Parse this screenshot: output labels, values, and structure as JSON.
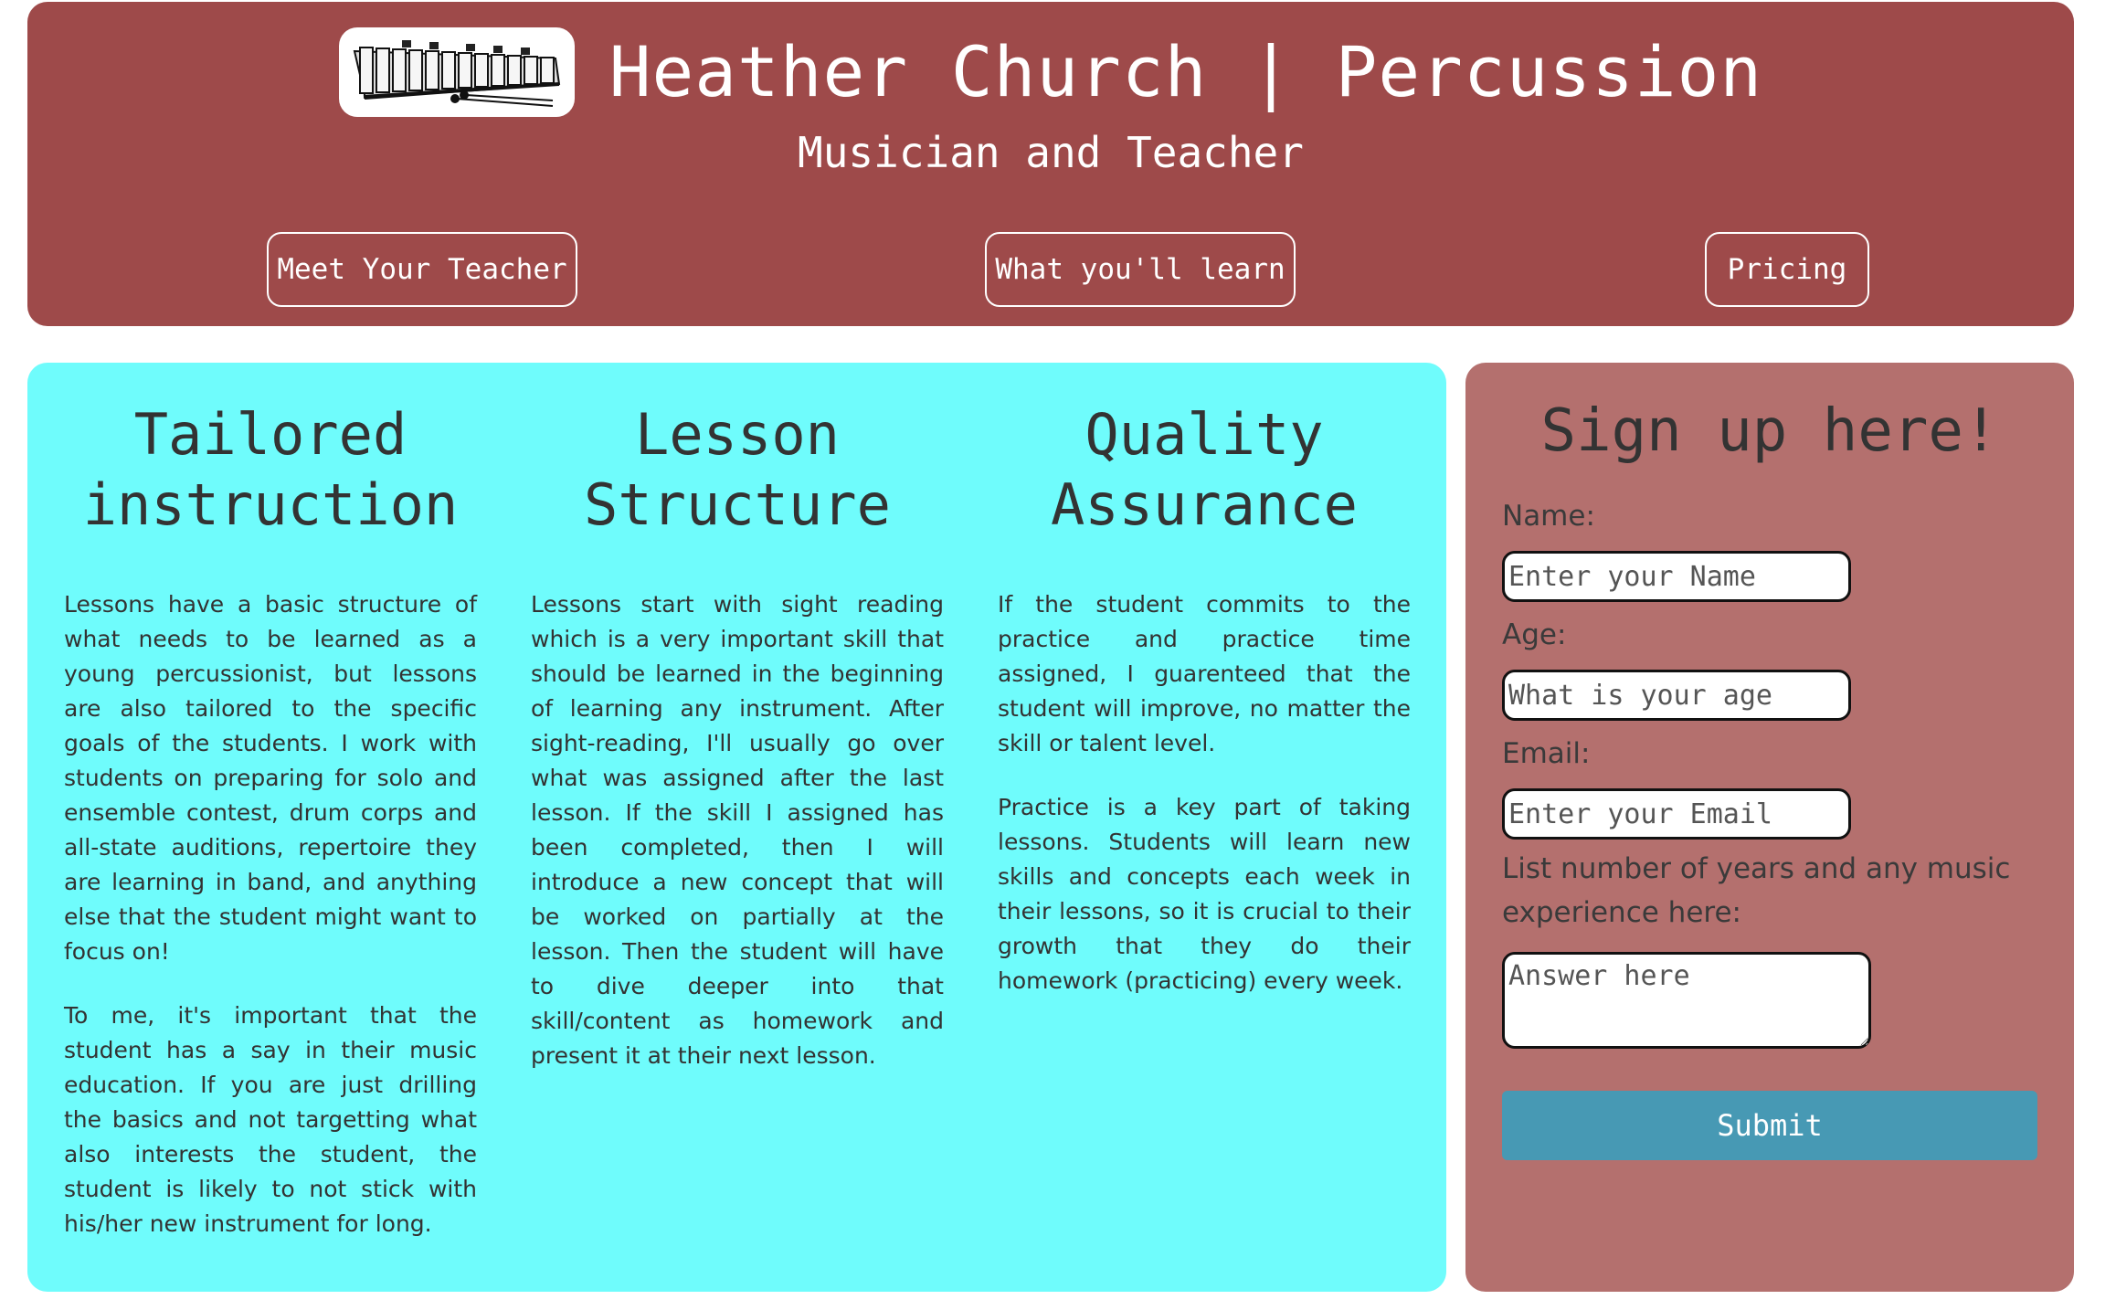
{
  "header": {
    "title": "Heather Church | Percussion",
    "subtitle": "Musician and Teacher",
    "logo_icon": "xylophone-icon",
    "nav": [
      {
        "label": "Meet Your Teacher"
      },
      {
        "label": "What you'll learn"
      },
      {
        "label": "Pricing"
      }
    ]
  },
  "columns": [
    {
      "heading_line1": "Tailored",
      "heading_line2": "instruction",
      "paragraphs": [
        "Lessons have a basic structure of what needs to be learned as a young percussionist, but lessons are also tailored to the specific goals of the students. I work with students on preparing for solo and ensemble contest, drum corps and all-state auditions, repertoire they are learning in band, and anything else that the student might want to focus on!",
        "To me, it's important that the student has a say in their music education. If you are just drilling the basics and not targetting what also interests the student, the student is likely to not stick with his/her new instrument for long."
      ]
    },
    {
      "heading_line1": "Lesson",
      "heading_line2": "Structure",
      "paragraphs": [
        "Lessons start with sight reading which is a very important skill that should be learned in the beginning of learning any instrument. After sight-reading, I'll usually go over what was assigned after the last lesson. If the skill I assigned has been completed, then I will introduce a new concept that will be worked on partially at the lesson. Then the student will have to dive deeper into that skill/content as homework and present it at their next lesson."
      ]
    },
    {
      "heading_line1": "Quality",
      "heading_line2": "Assurance",
      "paragraphs": [
        "If the student commits to the practice and practice time assigned, I guarenteed that the student will improve, no matter the skill or talent level.",
        "Practice is a key part of taking lessons. Students will learn new skills and concepts each week in their lessons, so it is crucial to their growth that they do their homework (practicing) every week."
      ]
    }
  ],
  "form": {
    "title": "Sign up here!",
    "name_label": "Name:",
    "name_placeholder": "Enter your Name",
    "age_label": "Age:",
    "age_placeholder": "What is your age",
    "email_label": "Email:",
    "email_placeholder": "Enter your Email",
    "experience_label": "List number of years and any music experience here:",
    "experience_placeholder": "Answer here",
    "submit_label": "Submit"
  },
  "colors": {
    "header_bg": "#9e4a4a",
    "main_bg": "#6ffcfc",
    "form_bg": "#b4706e",
    "submit_bg": "#4799b4"
  }
}
